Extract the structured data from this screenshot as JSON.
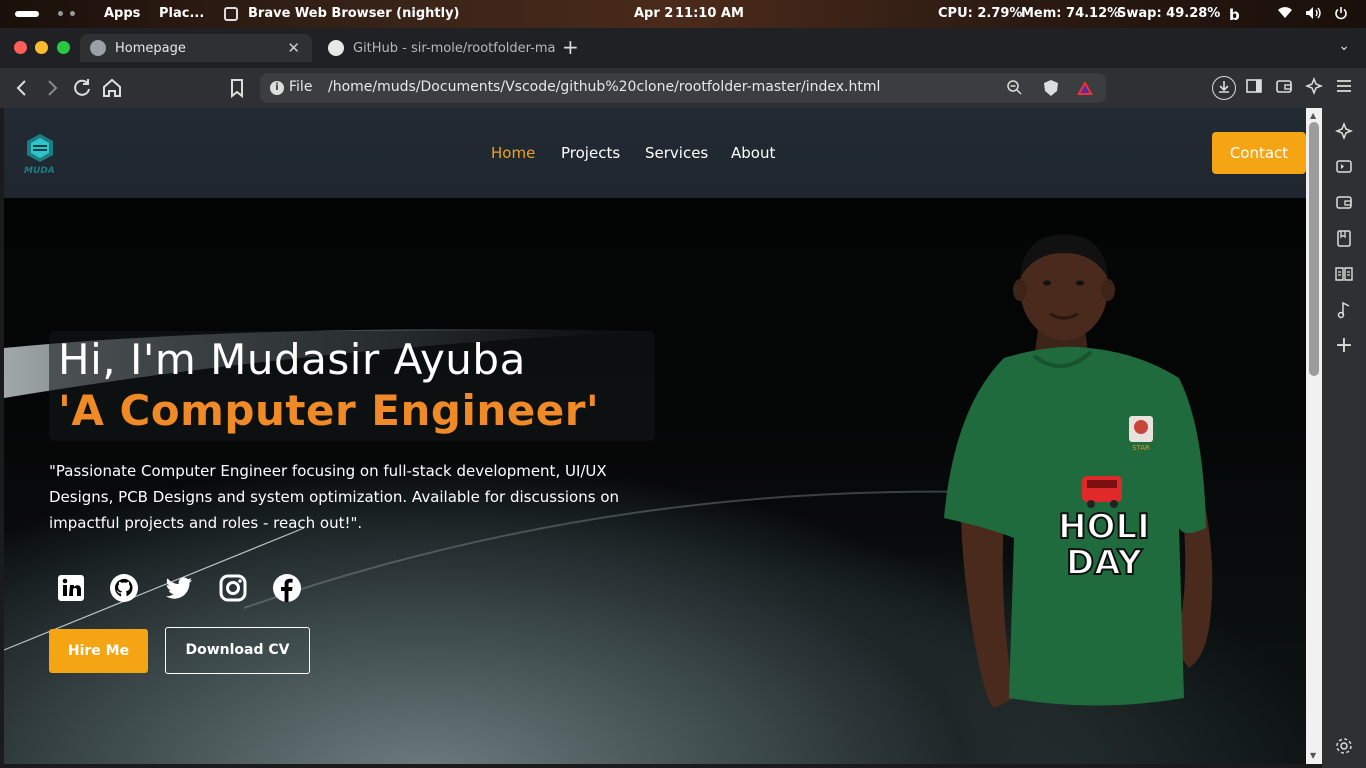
{
  "system_bar": {
    "apps": "Apps",
    "places": "Plac...",
    "active_app": "Brave Web Browser (nightly)",
    "date": "Apr 2",
    "time": "11:10 AM",
    "cpu": "CPU: 2.79%",
    "mem": "Mem: 74.12%",
    "swap": "Swap: 49.28%"
  },
  "tabs": [
    {
      "title": "Homepage",
      "active": true
    },
    {
      "title": "GitHub - sir-mole/rootfolder-mast",
      "active": false
    }
  ],
  "address_bar": {
    "scheme": "File",
    "url": "/home/muds/Documents/Vscode/github%20clone/rootfolder-master/index.html"
  },
  "site": {
    "logo_text": "MUDA",
    "nav": [
      "Home",
      "Projects",
      "Services",
      "About"
    ],
    "active_nav": "Home",
    "contact_label": "Contact",
    "hero": {
      "greeting": "Hi, I'm Mudasir Ayuba",
      "role": "'A Computer Engineer'",
      "description": "\"Passionate Computer Engineer focusing on full-stack development, UI/UX Designs, PCB Designs and system optimization. Available for discussions on impactful projects and roles - reach out!\".",
      "socials": [
        "linkedin-icon",
        "github-icon",
        "twitter-icon",
        "instagram-icon",
        "facebook-icon"
      ],
      "hire_label": "Hire Me",
      "cv_label": "Download CV",
      "shirt_text_1": "HOLI",
      "shirt_text_2": "DAY",
      "badge_text": "STAR"
    }
  },
  "colors": {
    "accent": "#f5a514",
    "role_orange": "#ef8a26",
    "header_bg": "#222a33"
  }
}
